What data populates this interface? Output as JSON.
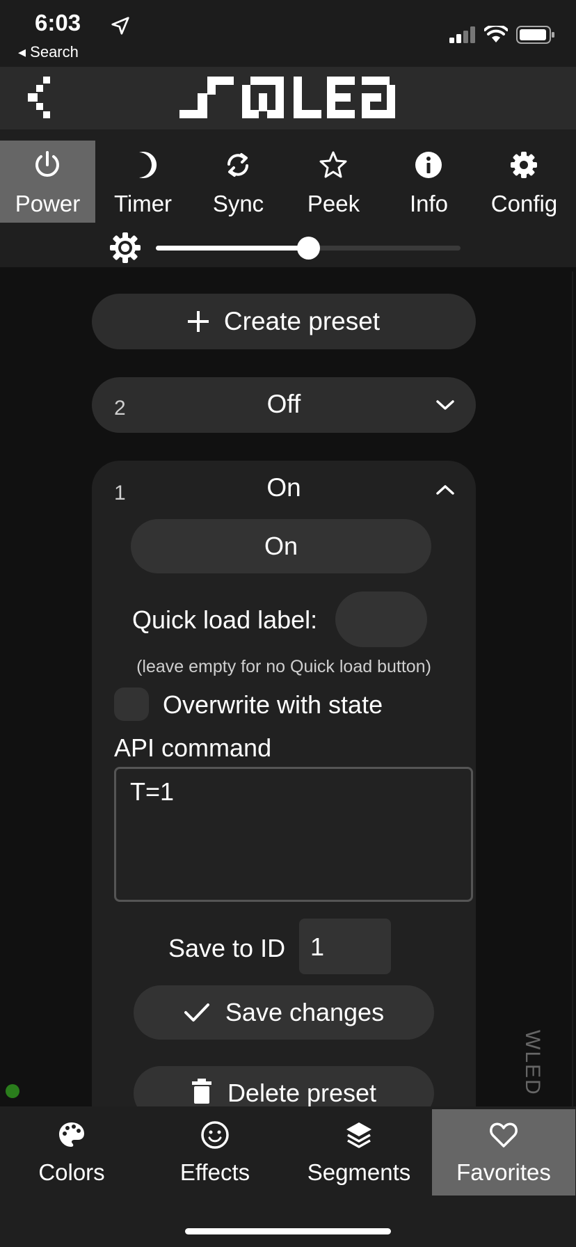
{
  "status_bar": {
    "time": "6:03",
    "back_label": "◂ Search"
  },
  "header": {
    "logo_alt": "WLED"
  },
  "top_nav": {
    "tabs": [
      {
        "label": "Power",
        "icon": "power-icon",
        "active": true
      },
      {
        "label": "Timer",
        "icon": "moon-icon",
        "active": false
      },
      {
        "label": "Sync",
        "icon": "sync-icon",
        "active": false
      },
      {
        "label": "Peek",
        "icon": "star-icon",
        "active": false
      },
      {
        "label": "Info",
        "icon": "info-icon",
        "active": false
      },
      {
        "label": "Config",
        "icon": "gear-icon",
        "active": false
      }
    ],
    "brightness": 0.5
  },
  "presets": {
    "create_label": "Create preset",
    "collapsed": {
      "id": "2",
      "name": "Off"
    },
    "expanded": {
      "id": "1",
      "name": "On",
      "apply_label": "On",
      "quick_load_label": "Quick load label:",
      "quick_load_value": "",
      "quick_load_hint": "(leave empty for no Quick load button)",
      "overwrite_label": "Overwrite with state",
      "overwrite_checked": false,
      "api_label": "API command",
      "api_value": "T=1",
      "save_id_label": "Save to ID",
      "save_id_value": "1",
      "save_label": "Save changes",
      "delete_label": "Delete preset"
    }
  },
  "watermark": "WLED",
  "bottom_nav": {
    "tabs": [
      {
        "label": "Colors",
        "icon": "palette-icon",
        "active": false
      },
      {
        "label": "Effects",
        "icon": "smiley-icon",
        "active": false
      },
      {
        "label": "Segments",
        "icon": "layers-icon",
        "active": false
      },
      {
        "label": "Favorites",
        "icon": "heart-icon",
        "active": true
      }
    ]
  },
  "colors": {
    "accent_active": "#666666",
    "background": "#111111",
    "panel": "#212121",
    "status_online": "#2a7d1c"
  }
}
